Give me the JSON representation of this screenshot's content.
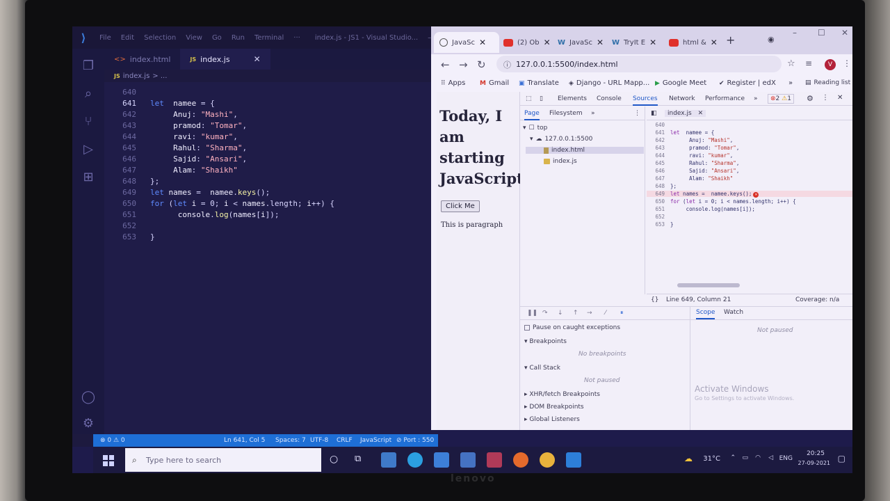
{
  "vscode": {
    "menu": [
      "File",
      "Edit",
      "Selection",
      "View",
      "Go",
      "Run",
      "Terminal",
      "···"
    ],
    "window_title": "index.js - JS1 - Visual Studio...",
    "tabs": [
      {
        "label": "index.html",
        "active": false
      },
      {
        "label": "index.js",
        "active": true
      }
    ],
    "breadcrumb": {
      "file": "index.js",
      "rest": "> ..."
    },
    "code_lines": [
      {
        "num": "640",
        "html": ""
      },
      {
        "num": "641",
        "html": "<span class=\"kw\">let</span>  <span class=\"prop\">namee</span> = {"
      },
      {
        "num": "642",
        "html": "     <span class=\"prop\">Anuj</span>: <span class=\"str\">\"Mashi\"</span>,"
      },
      {
        "num": "643",
        "html": "     <span class=\"prop\">pramod</span>: <span class=\"str\">\"Tomar\"</span>,"
      },
      {
        "num": "644",
        "html": "     <span class=\"prop\">ravi</span>: <span class=\"str\">\"kumar\"</span>,"
      },
      {
        "num": "645",
        "html": "     <span class=\"prop\">Rahul</span>: <span class=\"str\">\"Sharma\"</span>,"
      },
      {
        "num": "646",
        "html": "     <span class=\"prop\">Sajid</span>: <span class=\"str\">\"Ansari\"</span>,"
      },
      {
        "num": "647",
        "html": "     <span class=\"prop\">Alam</span>: <span class=\"str\">\"Shaikh\"</span>"
      },
      {
        "num": "648",
        "html": "};"
      },
      {
        "num": "649",
        "html": "<span class=\"kw\">let</span> <span class=\"prop\">names</span> =  <span class=\"prop\">namee</span>.<span class=\"fn\">keys</span>();"
      },
      {
        "num": "650",
        "html": "<span class=\"kw\">for</span> (<span class=\"kw\">let</span> <span class=\"prop\">i</span> = 0; <span class=\"prop\">i</span> &lt; <span class=\"prop\">names</span>.length; <span class=\"prop\">i</span>++) {"
      },
      {
        "num": "651",
        "html": "      <span class=\"prop\">console</span>.<span class=\"fn\">log</span>(<span class=\"prop\">names</span>[<span class=\"prop\">i</span>]);"
      },
      {
        "num": "652",
        "html": ""
      },
      {
        "num": "653",
        "html": "}"
      }
    ],
    "status": {
      "problems": "⊗ 0 ⚠ 0",
      "position": "Ln 641, Col 5",
      "spaces": "Spaces: 7",
      "encoding": "UTF-8",
      "eol": "CRLF",
      "language": "JavaScript",
      "port": "⊘ Port : 550"
    }
  },
  "chrome": {
    "tabs": [
      {
        "label": "JavaSc",
        "fav": "globe",
        "active": true
      },
      {
        "label": "(2) Ob",
        "fav": "yt",
        "active": false
      },
      {
        "label": "JavaSc",
        "fav": "w",
        "active": false
      },
      {
        "label": "TryIt E",
        "fav": "w",
        "active": false
      },
      {
        "label": "html &",
        "fav": "yt",
        "active": false
      }
    ],
    "url": "127.0.0.1:5500/index.html",
    "bookmarks": [
      "Apps",
      "Gmail",
      "Translate",
      "Django - URL Mapp...",
      "Google Meet",
      "Register | edX"
    ],
    "bookmarks_more": "»",
    "reading_list": "Reading list",
    "page": {
      "heading": "Today, I am starting JavaScript",
      "button": "Click Me",
      "paragraph": "This is paragraph"
    }
  },
  "devtools": {
    "tabs": [
      "Elements",
      "Console",
      "Sources",
      "Network",
      "Performance",
      "»"
    ],
    "active_tab": "Sources",
    "badges": {
      "errors": "2",
      "warnings": "1"
    },
    "nav_tabs": [
      "Page",
      "Filesystem",
      "»"
    ],
    "tree": {
      "top": "top",
      "host": "127.0.0.1:5500",
      "files": [
        "index.html",
        "index.js"
      ]
    },
    "open_file": "index.js",
    "code_lines": [
      {
        "num": "640",
        "html": ""
      },
      {
        "num": "641",
        "html": "<span class=\"dkw\">let</span>  namee = {"
      },
      {
        "num": "642",
        "html": "      Anuj: <span class=\"dstr\">\"Mashi\"</span>,"
      },
      {
        "num": "643",
        "html": "      pramod: <span class=\"dstr\">\"Tomar\"</span>,"
      },
      {
        "num": "644",
        "html": "      ravi: <span class=\"dstr\">\"kumar\"</span>,"
      },
      {
        "num": "645",
        "html": "      Rahul: <span class=\"dstr\">\"Sharma\"</span>,"
      },
      {
        "num": "646",
        "html": "      Sajid: <span class=\"dstr\">\"Ansari\"</span>,"
      },
      {
        "num": "647",
        "html": "      Alam: <span class=\"dstr\">\"Shaikh\"</span>"
      },
      {
        "num": "648",
        "html": "};"
      },
      {
        "num": "649",
        "html": "<span class=\"dkw\">let</span> names =  namee.keys();"
      },
      {
        "num": "650",
        "html": "<span class=\"dkw\">for</span> (<span class=\"dkw\">let</span> i = 0; i &lt; names.length; i++) {"
      },
      {
        "num": "651",
        "html": "     console.log(names[i]);"
      },
      {
        "num": "652",
        "html": ""
      },
      {
        "num": "653",
        "html": "}"
      }
    ],
    "status": {
      "braces": "{}",
      "position": "Line 649, Column 21",
      "coverage": "Coverage: n/a"
    },
    "pause_on_caught": "Pause on caught exceptions",
    "sections": {
      "breakpoints": "Breakpoints",
      "no_breakpoints": "No breakpoints",
      "call_stack": "Call Stack",
      "not_paused": "Not paused",
      "xhr": "XHR/fetch Breakpoints",
      "dom": "DOM Breakpoints",
      "global": "Global Listeners"
    },
    "scope_tabs": [
      "Scope",
      "Watch"
    ],
    "scope_not_paused": "Not paused",
    "watermark_title": "Activate Windows",
    "watermark_sub": "Go to Settings to activate Windows."
  },
  "taskbar": {
    "search_placeholder": "Type here to search",
    "weather": "31°C",
    "language": "ENG",
    "time": "20:25",
    "date": "27-09-2021"
  },
  "brand": "lenovo"
}
